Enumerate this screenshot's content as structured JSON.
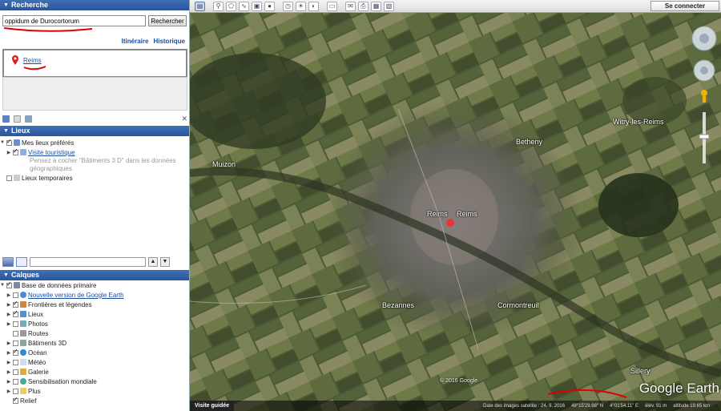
{
  "search": {
    "panel_title": "Recherche",
    "query": "oppidum de Durocortorum",
    "button": "Rechercher",
    "links": [
      "Itinéraire",
      "Historique"
    ],
    "result": "Reims"
  },
  "places": {
    "panel_title": "Lieux",
    "items": [
      {
        "label": "Mes lieux préférés"
      },
      {
        "label": "Visite touristique"
      },
      {
        "label": "Pensez à cocher \"Bâtiments 3 D\" dans les données géographiques"
      },
      {
        "label": "Lieux temporaires"
      }
    ]
  },
  "layers": {
    "panel_title": "Calques",
    "items": [
      {
        "label": "Base de données primaire"
      },
      {
        "label": "Nouvelle version de Google Earth"
      },
      {
        "label": "Frontières et légendes"
      },
      {
        "label": "Lieux"
      },
      {
        "label": "Photos"
      },
      {
        "label": "Routes"
      },
      {
        "label": "Bâtiments 3D"
      },
      {
        "label": "Océan"
      },
      {
        "label": "Météo"
      },
      {
        "label": "Galerie"
      },
      {
        "label": "Sensibilisation mondiale"
      },
      {
        "label": "Plus"
      },
      {
        "label": "Relief"
      }
    ]
  },
  "toolbar": {
    "sign_in": "Se connecter"
  },
  "map": {
    "labels": {
      "reims": "Reims",
      "reims_dup": "Reims",
      "betheny": "Betheny",
      "witry": "Witry-les-Reims",
      "muizon": "Muizon",
      "bezannes": "Bezannes",
      "cormontreuil": "Cormontreuil",
      "sillery": "Sillery"
    },
    "copyright": "© 2016 Google",
    "logo": "Google Earth",
    "footer": {
      "tour": "Visite guidée",
      "date": "Date des images satellite : 24. 9. 2016",
      "lat": "49°15'29.98\" N",
      "lon": "4°01'54.11\" E",
      "elev": "élév. 91 m",
      "alt": "altitude 19.65 km"
    }
  },
  "colors": {
    "panel_header": "#2a559a",
    "link": "#1a4fa0",
    "annotation": "#e00000"
  }
}
